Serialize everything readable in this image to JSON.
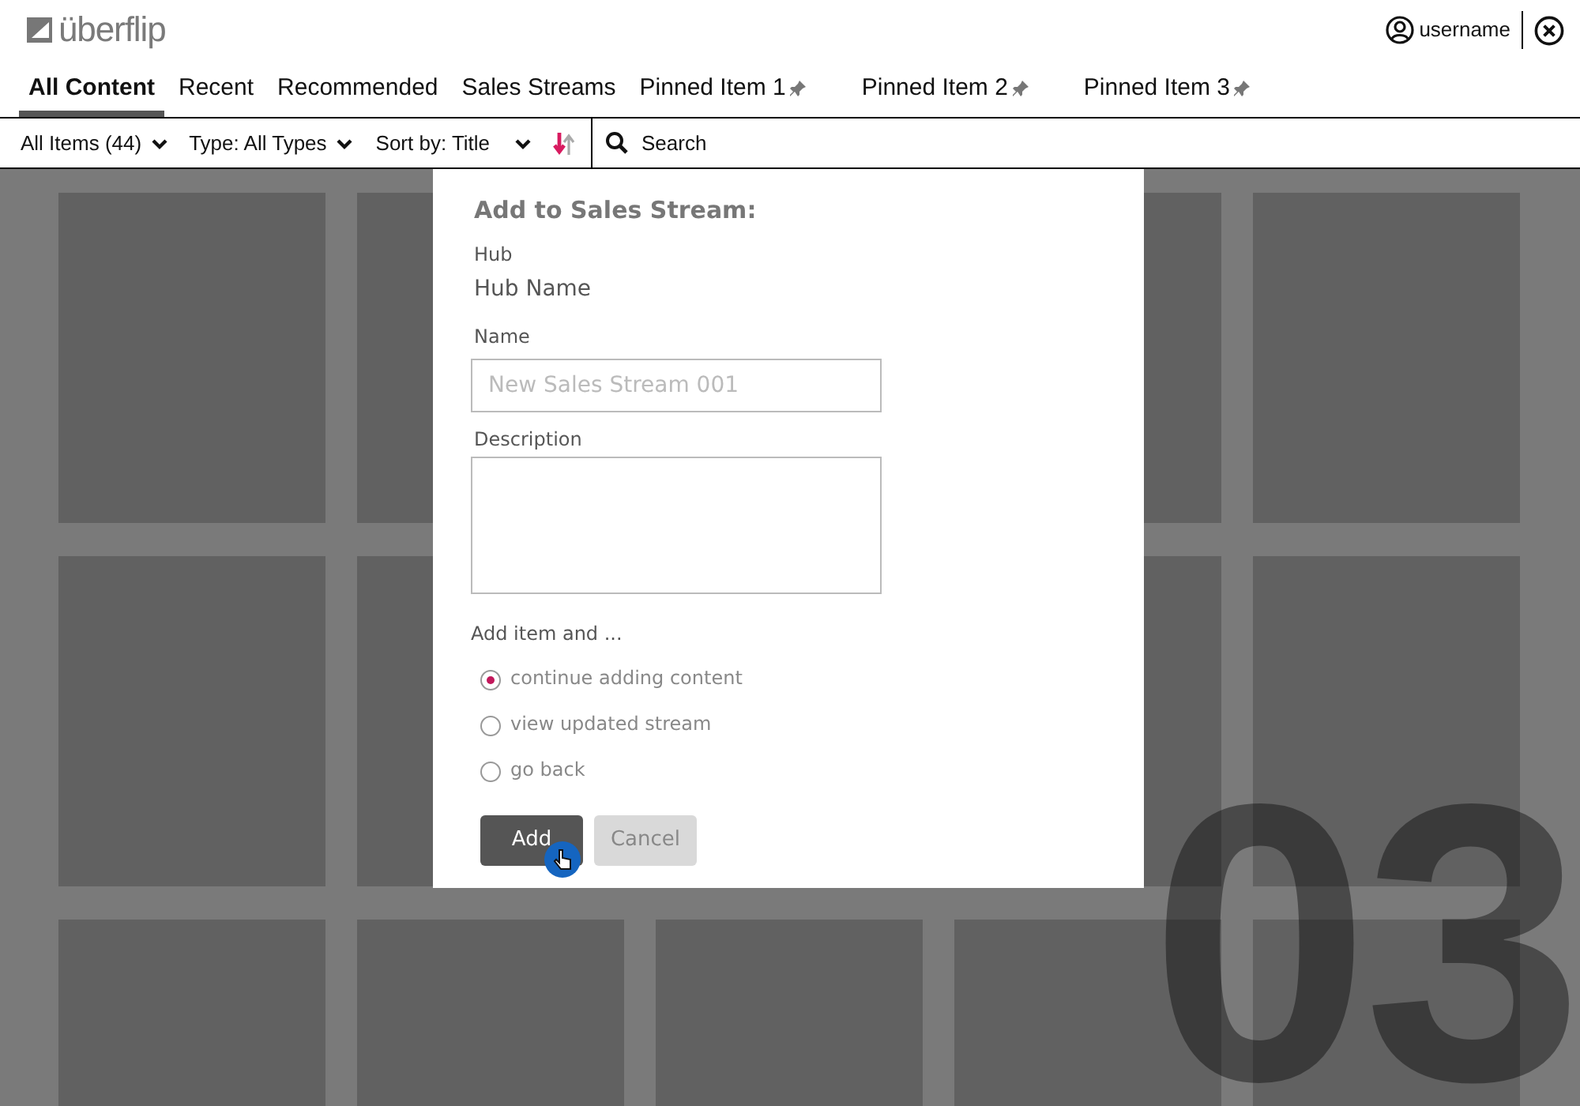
{
  "logo": {
    "text": "überflip"
  },
  "user": {
    "name": "username"
  },
  "tabs": [
    {
      "label": "All Content",
      "selected": true,
      "pinned": false
    },
    {
      "label": "Recent",
      "selected": false,
      "pinned": false
    },
    {
      "label": "Recommended",
      "selected": false,
      "pinned": false
    },
    {
      "label": "Sales Streams",
      "selected": false,
      "pinned": false
    },
    {
      "label": "Pinned Item 1",
      "selected": false,
      "pinned": true
    },
    {
      "label": "Pinned Item 2",
      "selected": false,
      "pinned": true
    },
    {
      "label": "Pinned Item 3",
      "selected": false,
      "pinned": true
    }
  ],
  "toolbar": {
    "filters": [
      {
        "label": "All Items (44)"
      },
      {
        "label": "Type: All Types"
      },
      {
        "label": "Sort by: Title"
      }
    ],
    "search": {
      "placeholder": "Search"
    }
  },
  "dialog": {
    "title": "Add to Sales Stream:",
    "hub_label": "Hub",
    "hub_value": "Hub Name",
    "name_label": "Name",
    "name_field": {
      "placeholder": "New Sales Stream 001"
    },
    "description_label": "Description",
    "options_label": "Add item and ...",
    "options": [
      {
        "label": "continue adding content",
        "selected": true
      },
      {
        "label": "view updated stream",
        "selected": false
      },
      {
        "label": "go back",
        "selected": false
      }
    ],
    "buttons": [
      {
        "label": "Add",
        "kind": "primary"
      },
      {
        "label": "Cancel",
        "kind": "secondary"
      }
    ]
  },
  "step_number": "03"
}
